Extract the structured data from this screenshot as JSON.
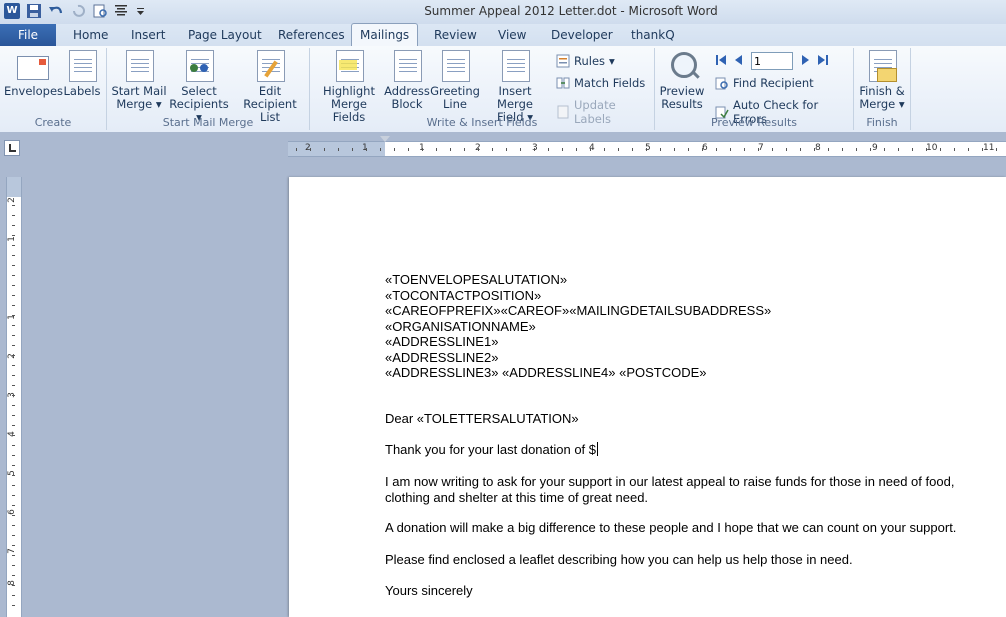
{
  "app": {
    "title": "Summer Appeal 2012 Letter.dot  -  Microsoft Word",
    "logo": "W"
  },
  "tabs": {
    "file": "File",
    "items": [
      "Home",
      "Insert",
      "Page Layout",
      "References",
      "Mailings",
      "Review",
      "View",
      "Developer",
      "thankQ"
    ]
  },
  "ribbon": {
    "create": {
      "label": "Create",
      "envelopes": "Envelopes",
      "labels": "Labels"
    },
    "start": {
      "label": "Start Mail Merge",
      "start_l1": "Start Mail",
      "start_l2": "Merge",
      "select_l1": "Select",
      "select_l2": "Recipients",
      "edit_l1": "Edit",
      "edit_l2": "Recipient List"
    },
    "write": {
      "label": "Write & Insert Fields",
      "highlight_l1": "Highlight",
      "highlight_l2": "Merge Fields",
      "address_l1": "Address",
      "address_l2": "Block",
      "greeting_l1": "Greeting",
      "greeting_l2": "Line",
      "insert_l1": "Insert Merge",
      "insert_l2": "Field",
      "rules": "Rules",
      "match": "Match Fields",
      "update": "Update Labels"
    },
    "preview": {
      "label": "Preview Results",
      "preview_l1": "Preview",
      "preview_l2": "Results",
      "record": "1",
      "find": "Find Recipient",
      "auto": "Auto Check for Errors"
    },
    "finish": {
      "label": "Finish",
      "finish_l1": "Finish &",
      "finish_l2": "Merge"
    }
  },
  "ruler": {
    "h_numbers": [
      "2",
      "1",
      "1",
      "2",
      "3",
      "4",
      "5",
      "6",
      "7",
      "8",
      "9",
      "10",
      "11",
      "12",
      "13",
      "14",
      "15"
    ],
    "v_numbers": [
      "2",
      "1",
      "1",
      "2",
      "3",
      "4",
      "5",
      "6",
      "7",
      "8",
      "9"
    ]
  },
  "document": {
    "address": [
      "«TOENVELOPESALUTATION»",
      "«TOCONTACTPOSITION»",
      "«CAREOFPREFIX»«CAREOF»«MAILINGDETAILSUBADDRESS»",
      "«ORGANISATIONNAME»",
      "«ADDRESSLINE1»",
      "«ADDRESSLINE2»",
      "«ADDRESSLINE3»  «ADDRESSLINE4»  «POSTCODE»"
    ],
    "salutation": "Dear «TOLETTERSALUTATION»",
    "thanks": "Thank  you for your last donation of $",
    "p1_l1": "I am now writing to ask for your support in our latest appeal to raise funds for those in need of food,",
    "p1_l2": "clothing and shelter at this time of great need.",
    "p2": "A donation will make a big difference to these people and I hope that we can count on your support.",
    "p3": "Please find enclosed a leaflet describing how you can help us help those in need.",
    "closing": "Yours sincerely"
  }
}
